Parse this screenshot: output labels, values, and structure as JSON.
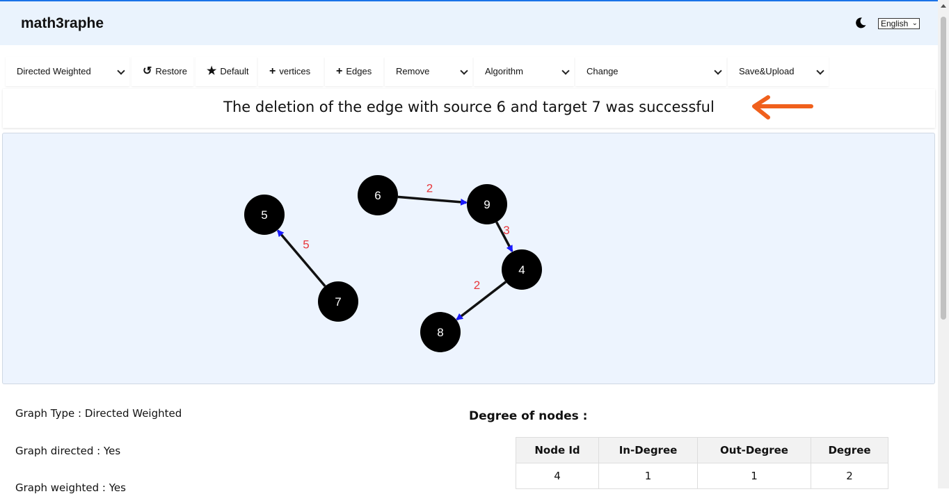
{
  "app": {
    "title": "math3raphe",
    "language": "English"
  },
  "toolbar": {
    "graph_type": "Directed Weighted",
    "restore": "Restore",
    "default": "Default",
    "add_vertices": "vertices",
    "add_edges": "Edges",
    "remove": "Remove",
    "algorithm": "Algorithm",
    "change": "Change",
    "save_upload": "Save&Upload"
  },
  "message": "The deletion of the edge with source 6 and target 7 was successful",
  "colors": {
    "accent_arrow": "#f0601c",
    "edge_weight": "#e8383d",
    "arrow_head": "#1a1aff",
    "node": "#000000",
    "canvas_bg": "#edf4fe",
    "header_bg": "#eaf3fd"
  },
  "graph": {
    "nodes": [
      {
        "id": "5"
      },
      {
        "id": "6"
      },
      {
        "id": "9"
      },
      {
        "id": "4"
      },
      {
        "id": "7"
      },
      {
        "id": "8"
      }
    ],
    "edges": [
      {
        "source": "6",
        "target": "9",
        "weight": "2"
      },
      {
        "source": "9",
        "target": "4",
        "weight": "3"
      },
      {
        "source": "4",
        "target": "8",
        "weight": "2"
      },
      {
        "source": "7",
        "target": "5",
        "weight": "5"
      }
    ]
  },
  "info": {
    "graph_type": "Graph Type : Directed Weighted",
    "directed": "Graph directed : Yes",
    "weighted": "Graph weighted : Yes"
  },
  "degree": {
    "title": "Degree of nodes :",
    "headers": [
      "Node Id",
      "In-Degree",
      "Out-Degree",
      "Degree"
    ],
    "rows": [
      [
        "4",
        "1",
        "1",
        "2"
      ]
    ]
  }
}
